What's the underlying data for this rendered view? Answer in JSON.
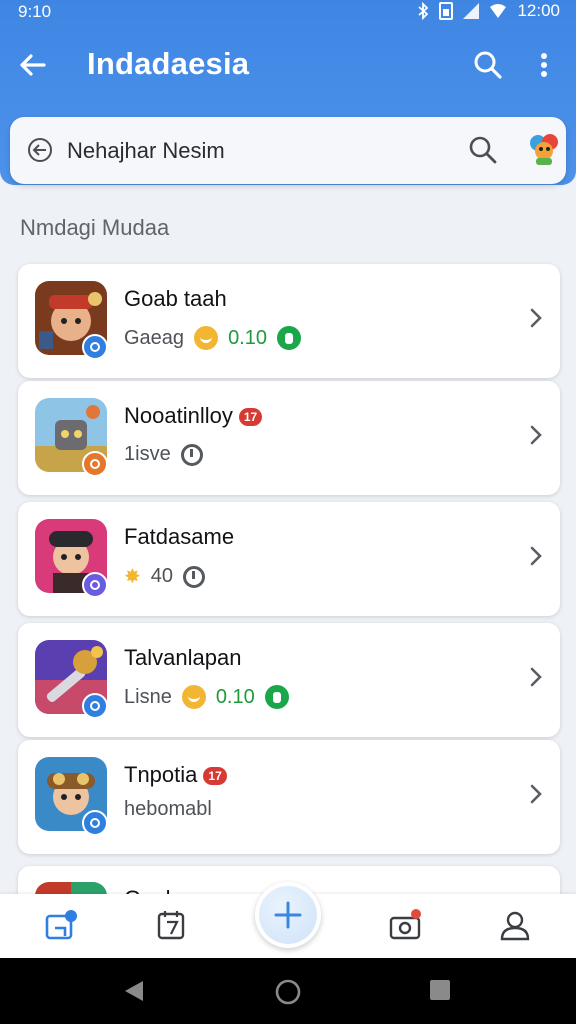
{
  "status_bar": {
    "time": "9:10",
    "clock_right": "12:00"
  },
  "app_bar": {
    "title": "Indadaesia"
  },
  "search": {
    "value": "Nehajhar Nesim"
  },
  "section": {
    "title": "Nmdagi Mudaa"
  },
  "apps": [
    {
      "name": "Goab taah",
      "meta_label": "Gaeag",
      "price": "0.10",
      "badge_color": "#2f7fe0",
      "icon": "adventurer-game-icon"
    },
    {
      "name": "Nooatinlloy",
      "hot": "17",
      "meta_label": "1isve",
      "badge_color": "#e4772c",
      "icon": "robot-game-icon"
    },
    {
      "name": "Fatdasame",
      "meta_label": "40",
      "badge_color": "#6a5ce0",
      "icon": "ninja-game-icon"
    },
    {
      "name": "Talvanlapan",
      "meta_label": "Lisne",
      "price": "0.10",
      "badge_color": "#2f7fe0",
      "icon": "hammer-game-icon"
    },
    {
      "name": "Tnpotia",
      "hot": "17",
      "meta_label": "hebomabl",
      "badge_color": "#2f7fe0",
      "icon": "pilot-game-icon"
    },
    {
      "name": "Gaol ...",
      "icon": "game-icon"
    }
  ],
  "colors": {
    "primary": "#4a8fe8",
    "price_green": "#1f9a3c",
    "hot_red": "#d63a33",
    "coin": "#f2b632"
  },
  "bottom_nav": {
    "items": [
      "home-icon",
      "calendar-icon",
      "add-icon",
      "camera-icon",
      "profile-icon"
    ]
  }
}
